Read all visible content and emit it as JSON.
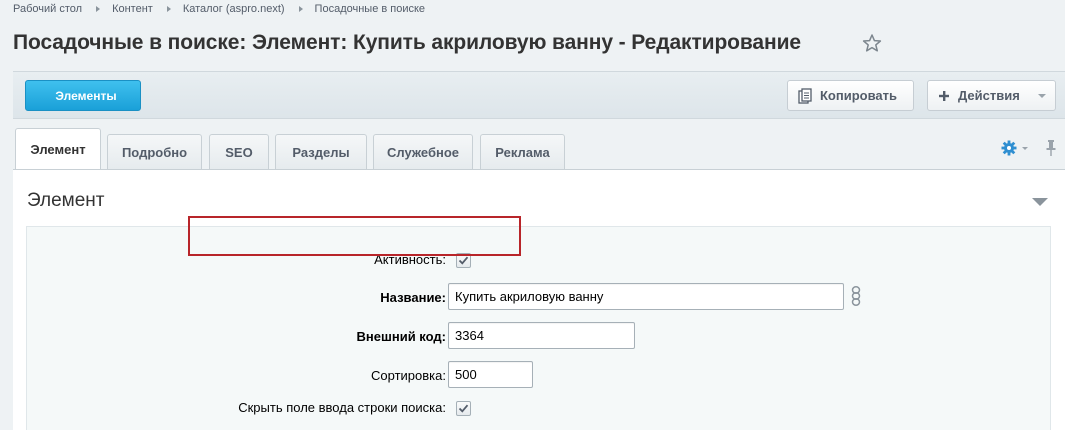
{
  "breadcrumb": [
    "Рабочий стол",
    "Контент",
    "Каталог (aspro.next)",
    "Посадочные в поиске"
  ],
  "page_title": "Посадочные в поиске: Элемент: Купить акриловую ванну - Редактирование",
  "toolbar": {
    "elements_label": "Элементы",
    "copy_label": "Копировать",
    "actions_label": "Действия"
  },
  "tabs": [
    "Элемент",
    "Подробно",
    "SEO",
    "Разделы",
    "Служебное",
    "Реклама"
  ],
  "section": {
    "title": "Элемент"
  },
  "fields": {
    "active": {
      "label": "Активность:",
      "checked": true
    },
    "name": {
      "label": "Название:",
      "value": "Купить акриловую ванну"
    },
    "external_code": {
      "label": "Внешний код:",
      "value": "3364"
    },
    "sort": {
      "label": "Сортировка:",
      "value": "500"
    },
    "hide_search": {
      "label": "Скрыть поле ввода строки поиска:",
      "checked": true
    }
  },
  "colors": {
    "accent": "#1aa0d8",
    "highlight": "#b8252a"
  }
}
